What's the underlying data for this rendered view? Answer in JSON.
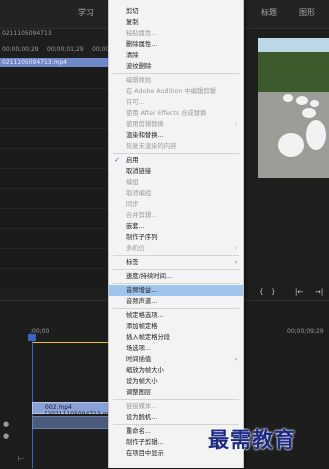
{
  "top_tabs": {
    "study": "学习",
    "titles": "标题",
    "graphics": "图形"
  },
  "sequence": {
    "name": "0211105094713"
  },
  "ruler_times": [
    "00;00;00;29",
    "00;00;01;29",
    "00;00;02"
  ],
  "project_clip": "0211105094713.mp4",
  "context_menu": {
    "items": [
      {
        "label": "剪切",
        "enabled": true
      },
      {
        "label": "复制",
        "enabled": true
      },
      {
        "label": "粘贴属性...",
        "enabled": false
      },
      {
        "label": "删除属性...",
        "enabled": true
      },
      {
        "label": "清除",
        "enabled": true
      },
      {
        "label": "波纹删除",
        "enabled": true
      },
      {
        "sep": true
      },
      {
        "label": "编辑原始",
        "enabled": false
      },
      {
        "label": "在 Adobe Audition 中编辑剪辑",
        "enabled": false
      },
      {
        "label": "许可...",
        "enabled": false
      },
      {
        "label": "使用 After Effects 合成替换",
        "enabled": false
      },
      {
        "label": "使用剪辑替换",
        "enabled": false,
        "submenu": true
      },
      {
        "label": "渲染和替换...",
        "enabled": true
      },
      {
        "label": "恢复未渲染的内容",
        "enabled": false
      },
      {
        "sep": true
      },
      {
        "label": "启用",
        "enabled": true,
        "checked": true
      },
      {
        "label": "取消链接",
        "enabled": true
      },
      {
        "label": "编组",
        "enabled": false
      },
      {
        "label": "取消编组",
        "enabled": false
      },
      {
        "label": "同步",
        "enabled": false
      },
      {
        "label": "合并剪辑...",
        "enabled": false
      },
      {
        "label": "嵌套...",
        "enabled": true
      },
      {
        "label": "制作子序列",
        "enabled": true
      },
      {
        "label": "多机位",
        "enabled": false,
        "submenu": true
      },
      {
        "sep": true
      },
      {
        "label": "标签",
        "enabled": true,
        "submenu": true
      },
      {
        "sep": true
      },
      {
        "label": "速度/持续时间...",
        "enabled": true
      },
      {
        "sep": true
      },
      {
        "label": "音频增益...",
        "enabled": true,
        "highlighted": true
      },
      {
        "label": "音频声道...",
        "enabled": true
      },
      {
        "sep": true
      },
      {
        "label": "帧定格选项...",
        "enabled": true
      },
      {
        "label": "添加帧定格",
        "enabled": true
      },
      {
        "label": "插入帧定格分段",
        "enabled": true
      },
      {
        "label": "场选项...",
        "enabled": true
      },
      {
        "label": "时间插值",
        "enabled": true,
        "submenu": true
      },
      {
        "label": "缩放为帧大小",
        "enabled": true
      },
      {
        "label": "设为帧大小",
        "enabled": true
      },
      {
        "label": "调整图层",
        "enabled": true
      },
      {
        "sep": true
      },
      {
        "label": "链接媒体...",
        "enabled": false
      },
      {
        "label": "设为脱机...",
        "enabled": true
      },
      {
        "sep": true
      },
      {
        "label": "重命名...",
        "enabled": true
      },
      {
        "label": "制作子剪辑...",
        "enabled": true
      },
      {
        "label": "在项目中显示",
        "enabled": true
      }
    ]
  },
  "bottom": {
    "time_start": ";00;00",
    "time_end": "00;00;09;29",
    "track_clip": "002.mp4 [20211105094713.mp4]"
  },
  "transport": {
    "marker_in": "{",
    "marker_out": "}",
    "go_in": "|←",
    "go_out": "→|"
  },
  "watermark": "最需教育",
  "colors": {
    "menu_bg": "#f3f3f3",
    "highlight": "#9ec6ec",
    "clip": "#8aa0d8",
    "playhead": "#3b64c9"
  }
}
